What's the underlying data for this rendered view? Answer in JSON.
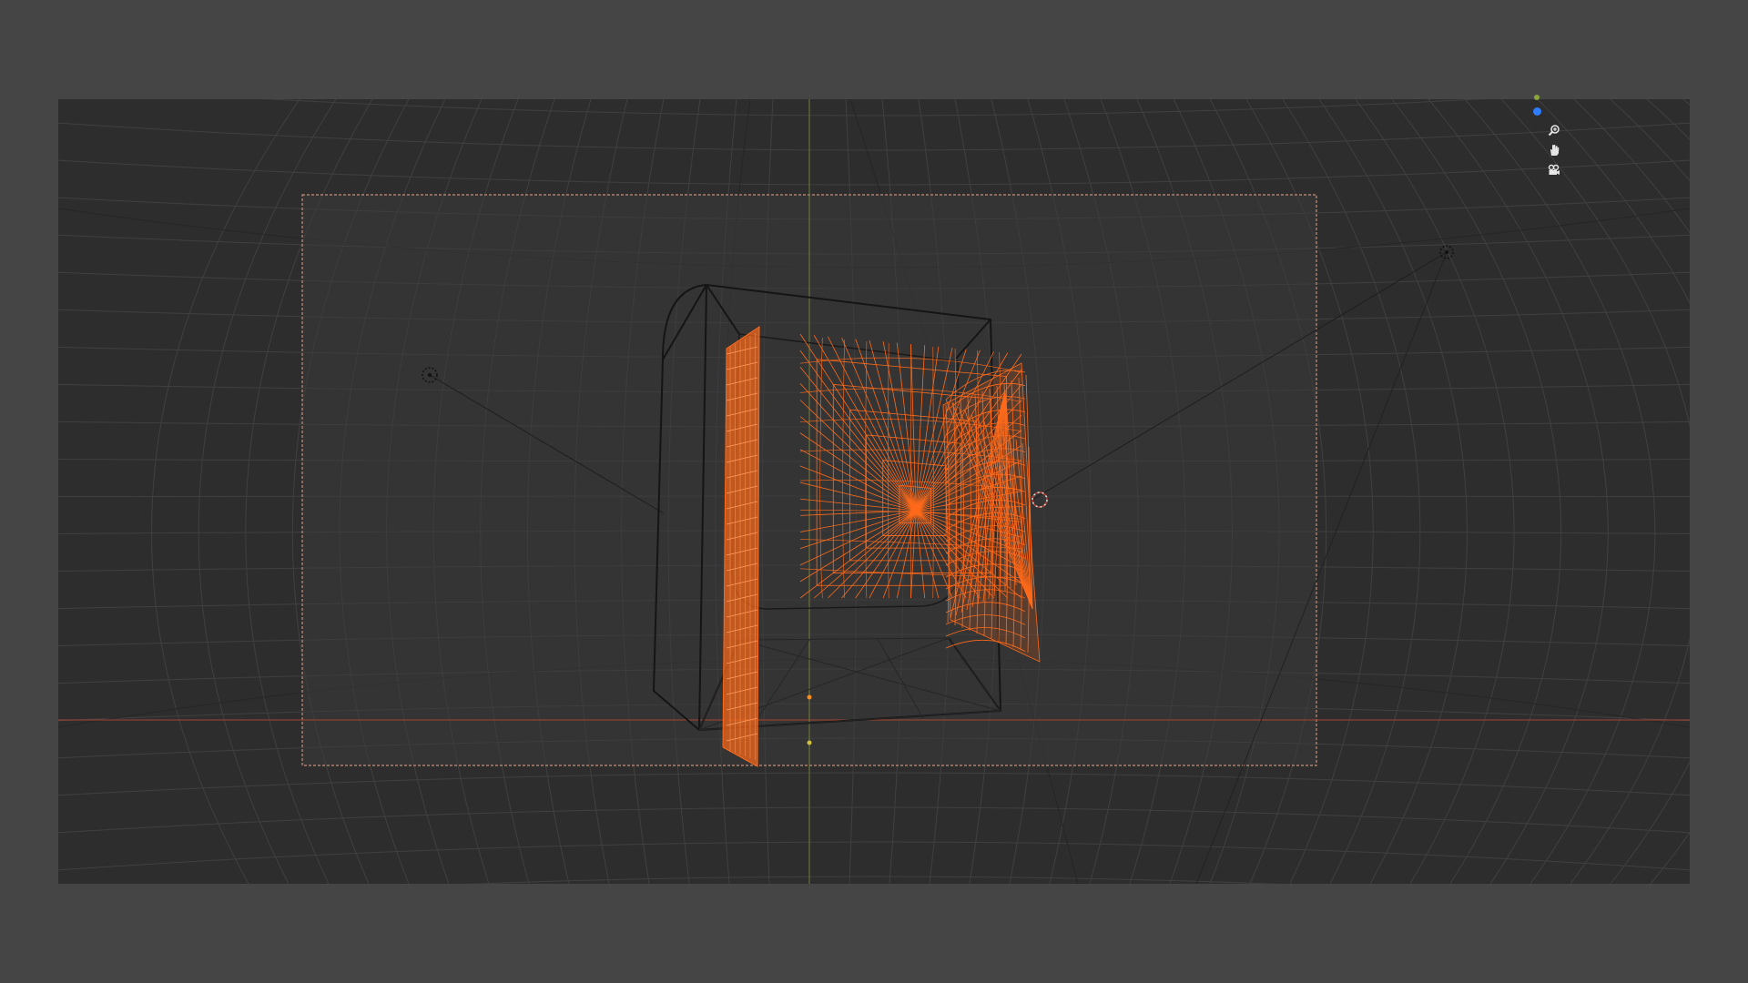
{
  "app": {
    "name": "3D viewport"
  },
  "colors": {
    "outer_bg": "#454545",
    "viewport_bg": "#2d2d2d",
    "grid": "#3a3a3a",
    "grid_major": "#4a4a4a",
    "selection_orange": "#ff6a1a",
    "camera_frame": "#c08070",
    "horizon_red": "#c0392b",
    "y_axis_green": "#8aa63a",
    "z_axis_blue": "#2f7dff"
  },
  "navigation": {
    "zoom_icon": "magnifier-zoom-icon",
    "pan_icon": "hand-pan-icon",
    "camera_icon": "camera-view-icon"
  }
}
